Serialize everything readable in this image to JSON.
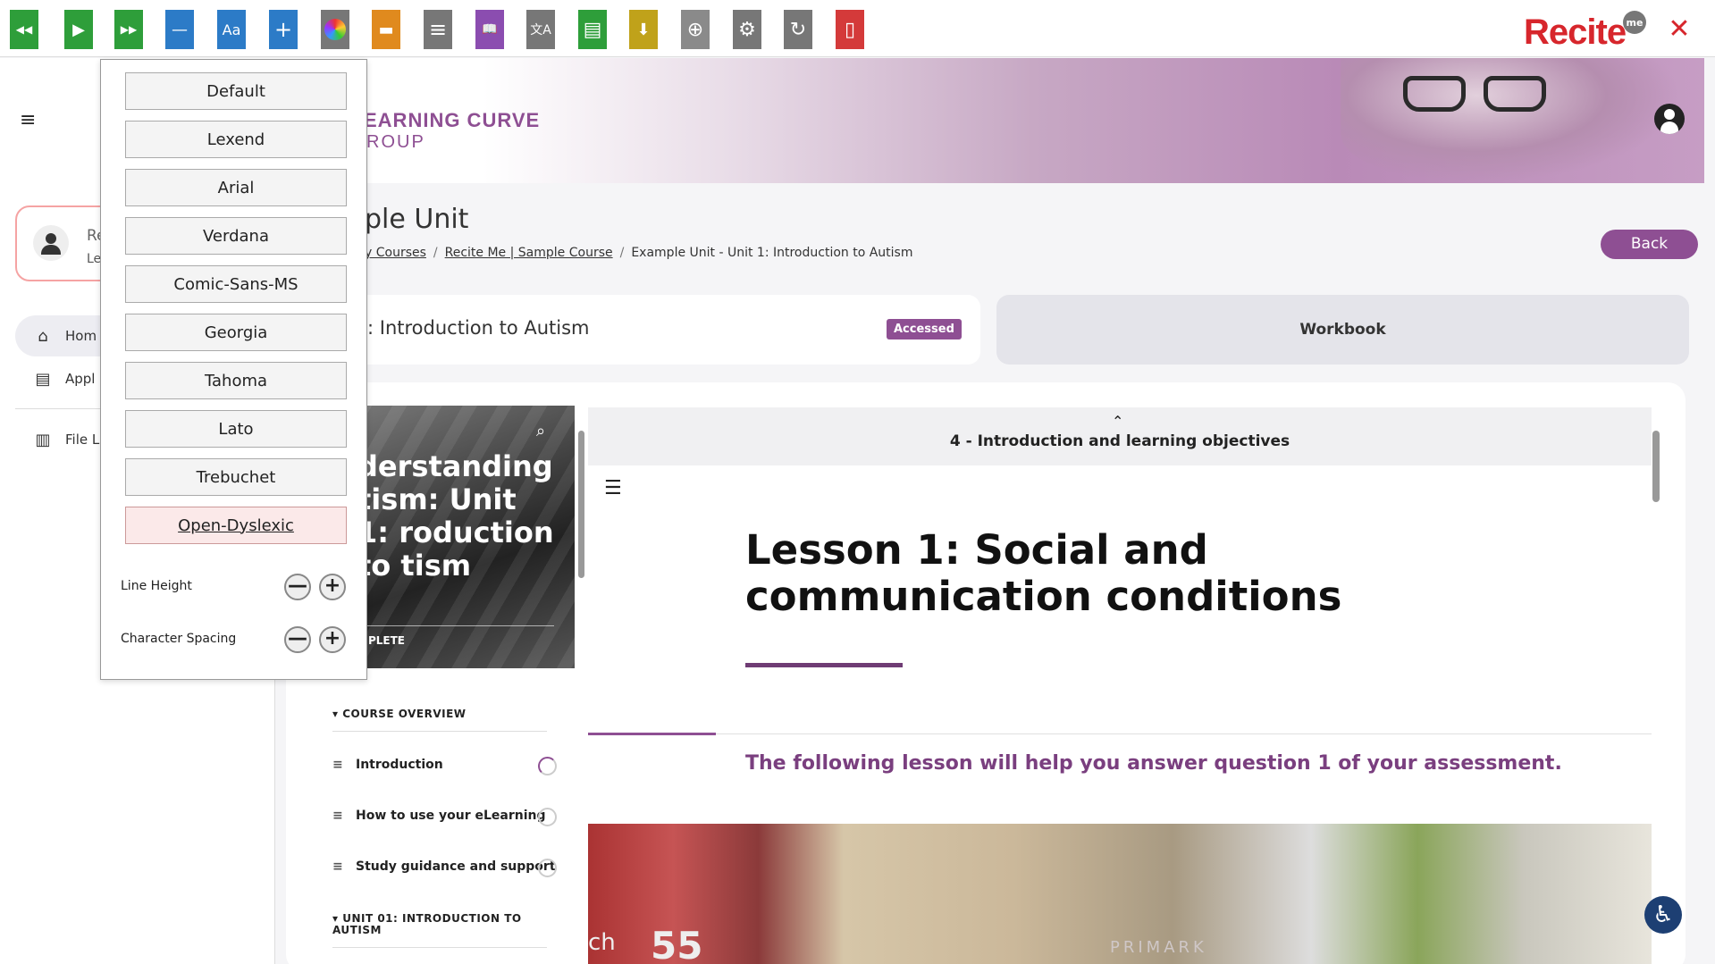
{
  "toolbar": {
    "buttons": [
      {
        "name": "rewind",
        "color": "#2e9e3a",
        "glyph": "◀◀"
      },
      {
        "name": "play",
        "color": "#2e9e3a",
        "glyph": "▶"
      },
      {
        "name": "fast-forward",
        "color": "#2e9e3a",
        "glyph": "▶▶"
      },
      {
        "name": "decrease-text",
        "color": "#2c7bc7",
        "glyph": "—"
      },
      {
        "name": "font",
        "color": "#2c7bc7",
        "glyph": "Aa"
      },
      {
        "name": "increase-text",
        "color": "#2c7bc7",
        "glyph": "+"
      },
      {
        "name": "color-settings",
        "color": "#777777",
        "glyph": "◉"
      },
      {
        "name": "ruler",
        "color": "#e08a1e",
        "glyph": "▬"
      },
      {
        "name": "screen-mask",
        "color": "#777777",
        "glyph": "≡"
      },
      {
        "name": "dictionary",
        "color": "#8b4db0",
        "glyph": "📖"
      },
      {
        "name": "translate",
        "color": "#777777",
        "glyph": "文A"
      },
      {
        "name": "text-only",
        "color": "#2e9e3a",
        "glyph": "▤"
      },
      {
        "name": "download-audio",
        "color": "#c0a21a",
        "glyph": "⬇"
      },
      {
        "name": "magnifier",
        "color": "#8a8a8a",
        "glyph": "⊕"
      },
      {
        "name": "settings",
        "color": "#777777",
        "glyph": "⚙"
      },
      {
        "name": "reset",
        "color": "#777777",
        "glyph": "↻"
      },
      {
        "name": "help",
        "color": "#d43a3a",
        "glyph": "▯"
      }
    ],
    "logo": "Recite",
    "logo_me": "me",
    "close_glyph": "✕"
  },
  "header": {
    "logo_line1": "EARNING CURVE",
    "logo_line2": "ROUP",
    "hamburger": "≡"
  },
  "sidebar": {
    "user_name": "Re",
    "user_role": "Le",
    "items": [
      {
        "label": "Hom",
        "icon": "⌂"
      },
      {
        "label": "Appl",
        "icon": "▤"
      },
      {
        "label": "File L",
        "icon": "▥"
      }
    ]
  },
  "main": {
    "page_title": "ple Unit",
    "breadcrumb": [
      "y Courses",
      "Recite Me | Sample Course",
      "Example Unit - Unit 1: Introduction to Autism"
    ],
    "back_label": "Back",
    "unit_card_title": ": Introduction to Autism",
    "badge": "Accessed",
    "workbook": "Workbook"
  },
  "course": {
    "image_title": "derstanding tism: Unit 1: roduction to tism",
    "image_status": "MPLETE",
    "section1": "COURSE OVERVIEW",
    "lessons": [
      "Introduction",
      "How to use your eLearning",
      "Study guidance and support"
    ],
    "section2": "UNIT 01: INTRODUCTION TO AUTISM"
  },
  "lesson": {
    "header": "4 - Introduction and learning objectives",
    "title": "Lesson 1: Social and communication conditions",
    "subtitle": "The following lesson will help you answer question 1 of your assessment.",
    "bus_number": "55",
    "bus_text": "ch",
    "shop_sign": "PRIMARK"
  },
  "font_panel": {
    "options": [
      "Default",
      "Lexend",
      "Arial",
      "Verdana",
      "Comic-Sans-MS",
      "Georgia",
      "Tahoma",
      "Lato",
      "Trebuchet",
      "Open-Dyslexic"
    ],
    "selected": "Open-Dyslexic",
    "line_height_label": "Line Height",
    "char_spacing_label": "Character Spacing",
    "minus": "—",
    "plus": "+"
  },
  "colors": {
    "brand_purple": "#8e4f93",
    "recite_red": "#d7262c"
  }
}
